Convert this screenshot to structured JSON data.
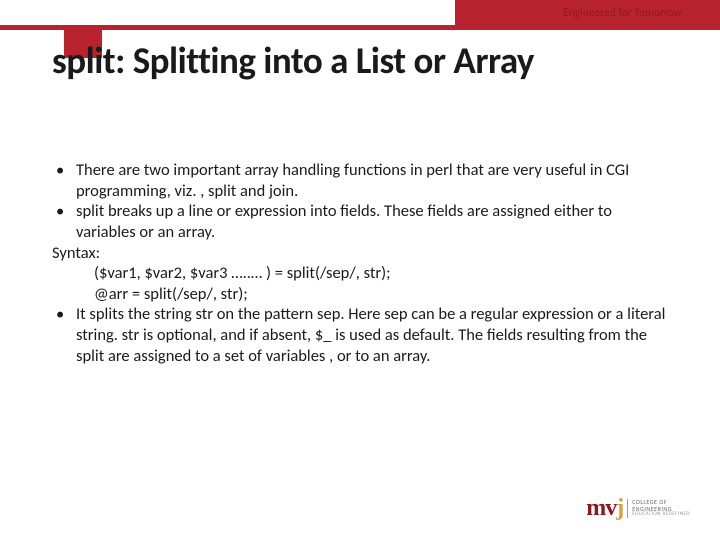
{
  "tagline": "Engineered for Tomorrow",
  "title": "split: Splitting into a List or Array",
  "bullets": {
    "b1": "There are two important array handling functions in perl that are very useful in CGI programming, viz. , split and join.",
    "b2": "split breaks up a line or expression into fields. These fields are assigned either to variables or an array.",
    "syntax_label": "Syntax:",
    "syntax_line1": "($var1, $var2, $var3 …..…  ) = split(/sep/, str);",
    "syntax_line2": "@arr = split(/sep/, str);",
    "b3": "It splits the string str on the pattern sep. Here sep can be a regular expression or a literal string. str is optional, and if absent, $_ is used as default. The fields resulting from the split are assigned to a set of variables , or to an array."
  },
  "logo": {
    "mark_left": "m",
    "mark_mid": "v",
    "mark_right": "j",
    "line1": "COLLEGE OF",
    "line2": "ENGINEERING",
    "line3": "EDUCATION REDEFINED"
  }
}
